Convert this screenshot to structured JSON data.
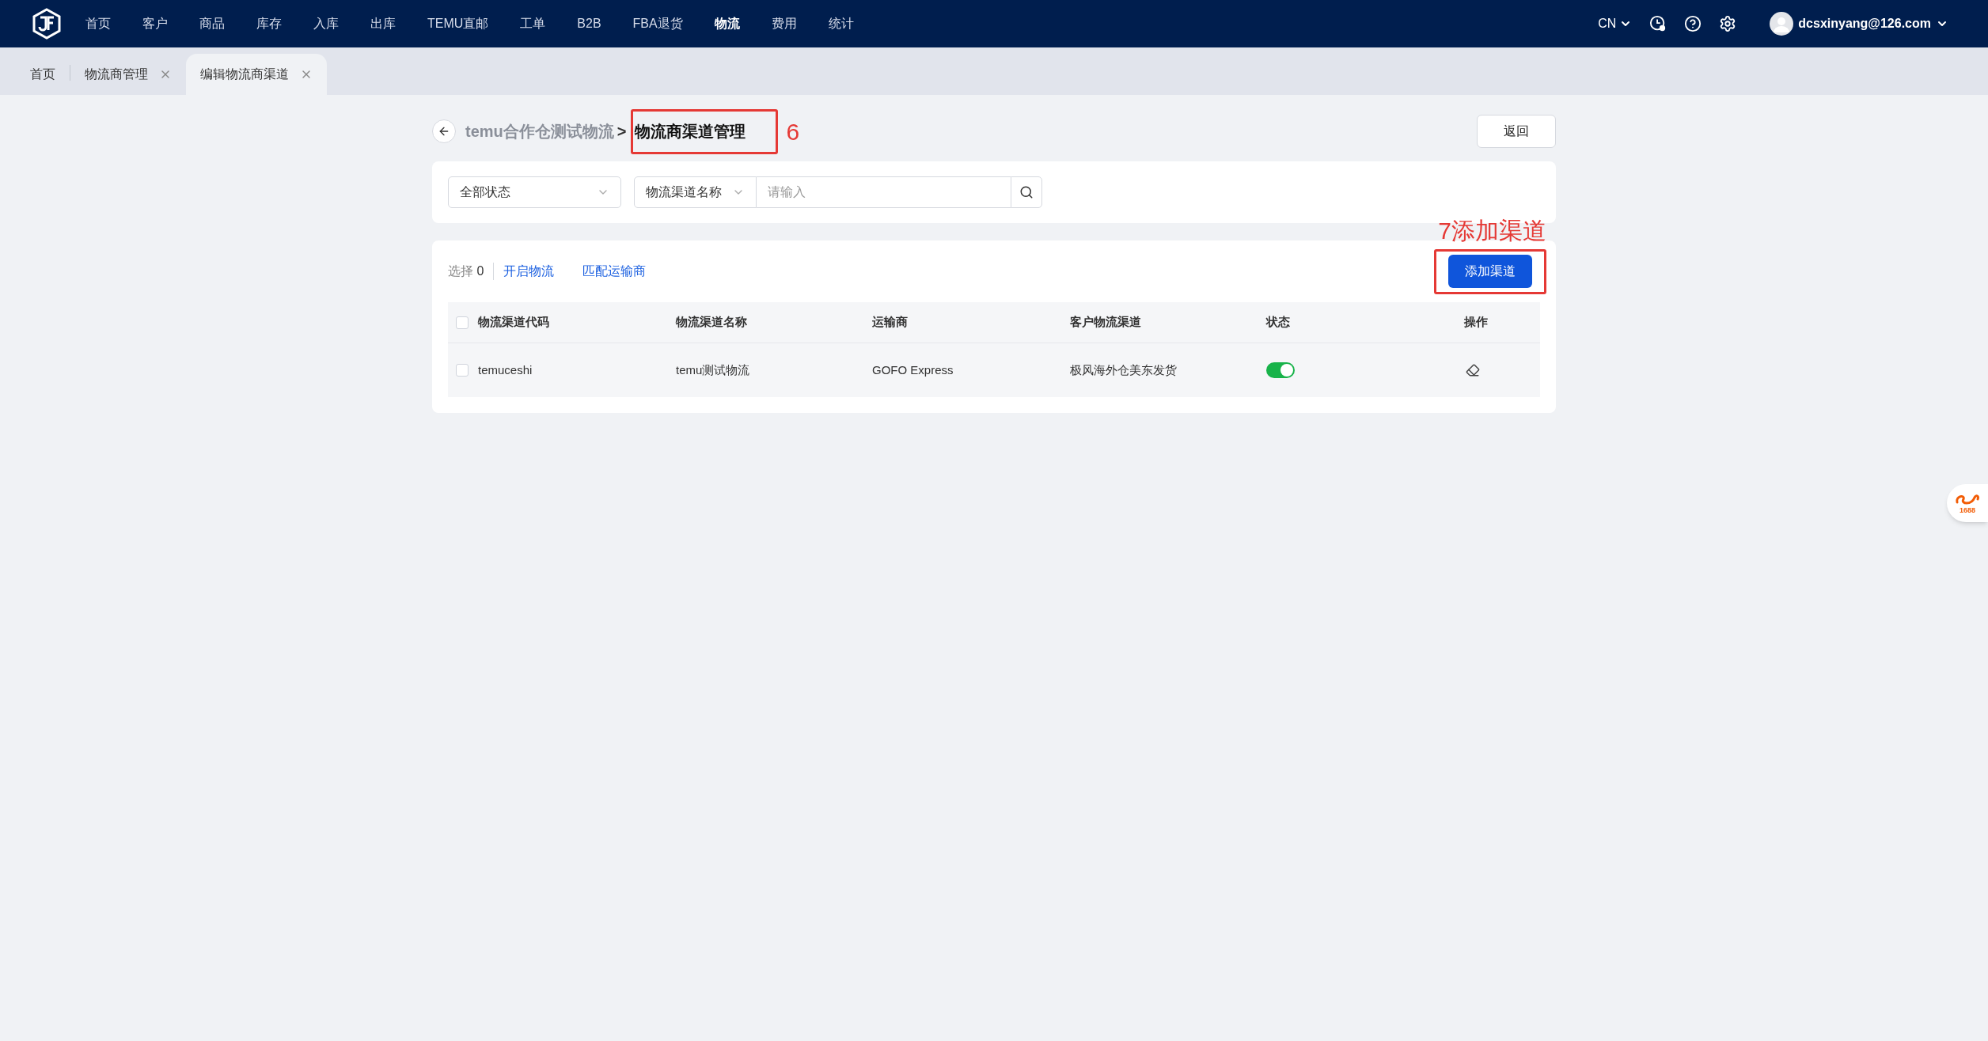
{
  "nav": {
    "menu": [
      {
        "label": "首页",
        "selected": false
      },
      {
        "label": "客户",
        "selected": false
      },
      {
        "label": "商品",
        "selected": false
      },
      {
        "label": "库存",
        "selected": false
      },
      {
        "label": "入库",
        "selected": false
      },
      {
        "label": "出库",
        "selected": false
      },
      {
        "label": "TEMU直邮",
        "selected": false
      },
      {
        "label": "工单",
        "selected": false
      },
      {
        "label": "B2B",
        "selected": false
      },
      {
        "label": "FBA退货",
        "selected": false
      },
      {
        "label": "物流",
        "selected": true
      },
      {
        "label": "费用",
        "selected": false
      },
      {
        "label": "统计",
        "selected": false
      }
    ],
    "language": "CN",
    "user": "dcsxinyang@126.com"
  },
  "tabs": [
    {
      "label": "首页",
      "selected": false,
      "closable": false
    },
    {
      "label": "物流商管理",
      "selected": false,
      "closable": true
    },
    {
      "label": "编辑物流商渠道",
      "selected": true,
      "closable": true
    }
  ],
  "breadcrumb": {
    "parent": "temu合作仓测试物流",
    "separator": ">",
    "current": "物流商渠道管理"
  },
  "annotations": [
    {
      "label": "6"
    },
    {
      "label": "7添加渠道"
    }
  ],
  "back_button": "返回",
  "filters": {
    "status": "全部状态",
    "field": "物流渠道名称",
    "search_placeholder": "请输入"
  },
  "toolbar": {
    "selected_label": "选择",
    "selected_count": "0",
    "actions": [
      "开启物流",
      "匹配运输商"
    ],
    "add_button": "添加渠道"
  },
  "table": {
    "header_checked": false,
    "columns": [
      "物流渠道代码",
      "物流渠道名称",
      "运输商",
      "客户物流渠道",
      "状态",
      "操作"
    ],
    "rows": [
      {
        "checked": false,
        "code": "temuceshi",
        "name": "temu测试物流",
        "carrier": "GOFO Express",
        "customer_channel": "极风海外仓美东发货",
        "on": true
      }
    ]
  },
  "side_badge": "1688"
}
